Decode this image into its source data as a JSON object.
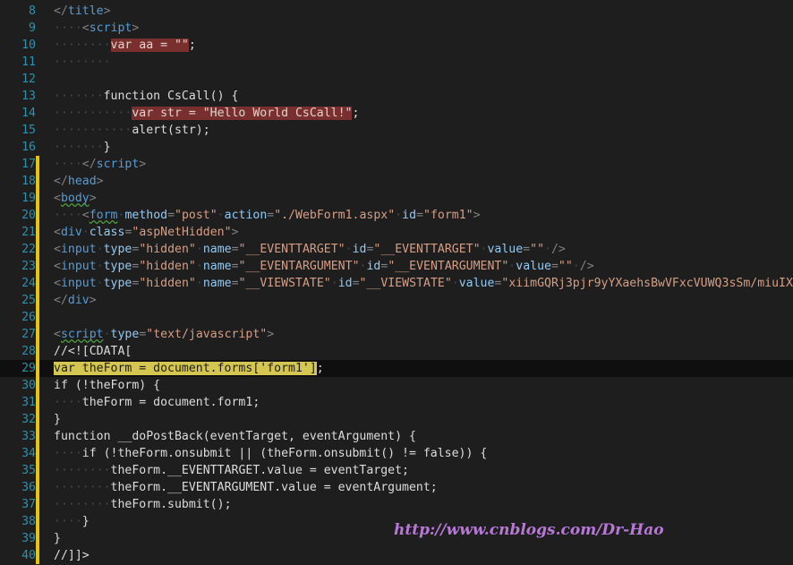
{
  "editor": {
    "watermark": "http://www.cnblogs.com/Dr-Hao",
    "lines": [
      {
        "n": "8",
        "changed": false,
        "current": false,
        "tokens": [
          [
            "br",
            "</"
          ],
          [
            "tag",
            "title"
          ],
          [
            "br",
            ">"
          ]
        ]
      },
      {
        "n": "9",
        "changed": false,
        "current": false,
        "tokens": [
          [
            "ws",
            "····"
          ],
          [
            "br",
            "<"
          ],
          [
            "tag",
            "script"
          ],
          [
            "br",
            ">"
          ]
        ]
      },
      {
        "n": "10",
        "changed": false,
        "current": false,
        "tokens": [
          [
            "ws",
            "········"
          ],
          [
            "hl-red",
            "var aa = \"\""
          ],
          [
            "kw",
            ";"
          ]
        ]
      },
      {
        "n": "11",
        "changed": false,
        "current": false,
        "tokens": [
          [
            "ws",
            "········"
          ]
        ]
      },
      {
        "n": "12",
        "changed": false,
        "current": false,
        "tokens": []
      },
      {
        "n": "13",
        "changed": false,
        "current": false,
        "tokens": [
          [
            "ws",
            "·······"
          ],
          [
            "kw",
            "function CsCall() {"
          ]
        ]
      },
      {
        "n": "14",
        "changed": false,
        "current": false,
        "tokens": [
          [
            "ws",
            "···········"
          ],
          [
            "hl-red",
            "var str = \"Hello World CsCall!\""
          ],
          [
            "kw",
            ";"
          ]
        ]
      },
      {
        "n": "15",
        "changed": false,
        "current": false,
        "tokens": [
          [
            "ws",
            "···········"
          ],
          [
            "kw",
            "alert(str);"
          ]
        ]
      },
      {
        "n": "16",
        "changed": false,
        "current": false,
        "tokens": [
          [
            "ws",
            "·······"
          ],
          [
            "kw",
            "}"
          ]
        ]
      },
      {
        "n": "17",
        "changed": true,
        "current": false,
        "tokens": [
          [
            "ws",
            "····"
          ],
          [
            "br",
            "</"
          ],
          [
            "tag",
            "script"
          ],
          [
            "br",
            ">"
          ]
        ]
      },
      {
        "n": "18",
        "changed": true,
        "current": false,
        "tokens": [
          [
            "br",
            "</"
          ],
          [
            "tag",
            "head"
          ],
          [
            "br",
            ">"
          ]
        ]
      },
      {
        "n": "19",
        "changed": true,
        "current": false,
        "tokens": [
          [
            "br",
            "<"
          ],
          [
            "tag sq",
            "body"
          ],
          [
            "br",
            ">"
          ]
        ]
      },
      {
        "n": "20",
        "changed": true,
        "current": false,
        "tokens": [
          [
            "ws",
            "····"
          ],
          [
            "br",
            "<"
          ],
          [
            "tag sq",
            "form"
          ],
          [
            "ws",
            "·"
          ],
          [
            "at",
            "method"
          ],
          [
            "br",
            "="
          ],
          [
            "st",
            "\"post\""
          ],
          [
            "ws",
            "·"
          ],
          [
            "at",
            "action"
          ],
          [
            "br",
            "="
          ],
          [
            "st",
            "\"./WebForm1.aspx\""
          ],
          [
            "ws",
            "·"
          ],
          [
            "at",
            "id"
          ],
          [
            "br",
            "="
          ],
          [
            "st",
            "\"form1\""
          ],
          [
            "br",
            ">"
          ]
        ]
      },
      {
        "n": "21",
        "changed": true,
        "current": false,
        "tokens": [
          [
            "br",
            "<"
          ],
          [
            "tag",
            "div"
          ],
          [
            "ws",
            "·"
          ],
          [
            "at",
            "class"
          ],
          [
            "br",
            "="
          ],
          [
            "st",
            "\"aspNetHidden\""
          ],
          [
            "br",
            ">"
          ]
        ]
      },
      {
        "n": "22",
        "changed": true,
        "current": false,
        "tokens": [
          [
            "br",
            "<"
          ],
          [
            "tag",
            "input"
          ],
          [
            "ws",
            "·"
          ],
          [
            "at",
            "type"
          ],
          [
            "br",
            "="
          ],
          [
            "st",
            "\"hidden\""
          ],
          [
            "ws",
            "·"
          ],
          [
            "at",
            "name"
          ],
          [
            "br",
            "="
          ],
          [
            "st",
            "\"__EVENTTARGET\""
          ],
          [
            "ws",
            "·"
          ],
          [
            "at",
            "id"
          ],
          [
            "br",
            "="
          ],
          [
            "st",
            "\"__EVENTTARGET\""
          ],
          [
            "ws",
            "·"
          ],
          [
            "at",
            "value"
          ],
          [
            "br",
            "="
          ],
          [
            "st",
            "\"\""
          ],
          [
            "ws",
            "·"
          ],
          [
            "br",
            "/>"
          ]
        ]
      },
      {
        "n": "23",
        "changed": true,
        "current": false,
        "tokens": [
          [
            "br",
            "<"
          ],
          [
            "tag",
            "input"
          ],
          [
            "ws",
            "·"
          ],
          [
            "at",
            "type"
          ],
          [
            "br",
            "="
          ],
          [
            "st",
            "\"hidden\""
          ],
          [
            "ws",
            "·"
          ],
          [
            "at",
            "name"
          ],
          [
            "br",
            "="
          ],
          [
            "st",
            "\"__EVENTARGUMENT\""
          ],
          [
            "ws",
            "·"
          ],
          [
            "at",
            "id"
          ],
          [
            "br",
            "="
          ],
          [
            "st",
            "\"__EVENTARGUMENT\""
          ],
          [
            "ws",
            "·"
          ],
          [
            "at",
            "value"
          ],
          [
            "br",
            "="
          ],
          [
            "st",
            "\"\""
          ],
          [
            "ws",
            "·"
          ],
          [
            "br",
            "/>"
          ]
        ]
      },
      {
        "n": "24",
        "changed": true,
        "current": false,
        "tokens": [
          [
            "br",
            "<"
          ],
          [
            "tag",
            "input"
          ],
          [
            "ws",
            "·"
          ],
          [
            "at",
            "type"
          ],
          [
            "br",
            "="
          ],
          [
            "st",
            "\"hidden\""
          ],
          [
            "ws",
            "·"
          ],
          [
            "at",
            "name"
          ],
          [
            "br",
            "="
          ],
          [
            "st",
            "\"__VIEWSTATE\""
          ],
          [
            "ws",
            "·"
          ],
          [
            "at",
            "id"
          ],
          [
            "br",
            "="
          ],
          [
            "st",
            "\"__VIEWSTATE\""
          ],
          [
            "ws",
            "·"
          ],
          [
            "at",
            "value"
          ],
          [
            "br",
            "="
          ],
          [
            "st",
            "\"xiimGQRj3pjr9yYXaehsBwVFxcVUWQ3sSm/miuIX"
          ]
        ]
      },
      {
        "n": "25",
        "changed": true,
        "current": false,
        "tokens": [
          [
            "br",
            "</"
          ],
          [
            "tag",
            "div"
          ],
          [
            "br",
            ">"
          ]
        ]
      },
      {
        "n": "26",
        "changed": true,
        "current": false,
        "tokens": []
      },
      {
        "n": "27",
        "changed": true,
        "current": false,
        "tokens": [
          [
            "br",
            "<"
          ],
          [
            "tag sq",
            "script"
          ],
          [
            "ws",
            "·"
          ],
          [
            "at",
            "type"
          ],
          [
            "br",
            "="
          ],
          [
            "st",
            "\"text/javascript\""
          ],
          [
            "br",
            ">"
          ]
        ]
      },
      {
        "n": "28",
        "changed": true,
        "current": false,
        "tokens": [
          [
            "kw",
            "//<![CDATA["
          ]
        ]
      },
      {
        "n": "29",
        "changed": true,
        "current": true,
        "tokens": [
          [
            "hl-yellow",
            "var theForm = document.forms['form1']"
          ],
          [
            "kw",
            ";"
          ]
        ]
      },
      {
        "n": "30",
        "changed": true,
        "current": false,
        "tokens": [
          [
            "kw",
            "if (!theForm) {"
          ]
        ]
      },
      {
        "n": "31",
        "changed": true,
        "current": false,
        "tokens": [
          [
            "ws",
            "····"
          ],
          [
            "kw",
            "theForm = document.form1;"
          ]
        ]
      },
      {
        "n": "32",
        "changed": true,
        "current": false,
        "tokens": [
          [
            "kw",
            "}"
          ]
        ]
      },
      {
        "n": "33",
        "changed": true,
        "current": false,
        "tokens": [
          [
            "kw",
            "function __doPostBack(eventTarget, eventArgument) {"
          ]
        ]
      },
      {
        "n": "34",
        "changed": true,
        "current": false,
        "tokens": [
          [
            "ws",
            "····"
          ],
          [
            "kw",
            "if (!theForm.onsubmit || (theForm.onsubmit() != false)) {"
          ]
        ]
      },
      {
        "n": "35",
        "changed": true,
        "current": false,
        "tokens": [
          [
            "ws",
            "········"
          ],
          [
            "kw",
            "theForm.__EVENTTARGET.value = eventTarget;"
          ]
        ]
      },
      {
        "n": "36",
        "changed": true,
        "current": false,
        "tokens": [
          [
            "ws",
            "········"
          ],
          [
            "kw",
            "theForm.__EVENTARGUMENT.value = eventArgument;"
          ]
        ]
      },
      {
        "n": "37",
        "changed": true,
        "current": false,
        "tokens": [
          [
            "ws",
            "········"
          ],
          [
            "kw",
            "theForm.submit();"
          ]
        ]
      },
      {
        "n": "38",
        "changed": true,
        "current": false,
        "tokens": [
          [
            "ws",
            "····"
          ],
          [
            "kw",
            "}"
          ]
        ]
      },
      {
        "n": "39",
        "changed": true,
        "current": false,
        "tokens": [
          [
            "kw",
            "}"
          ]
        ]
      },
      {
        "n": "40",
        "changed": true,
        "current": false,
        "tokens": [
          [
            "kw",
            "//]]>"
          ]
        ]
      }
    ]
  }
}
